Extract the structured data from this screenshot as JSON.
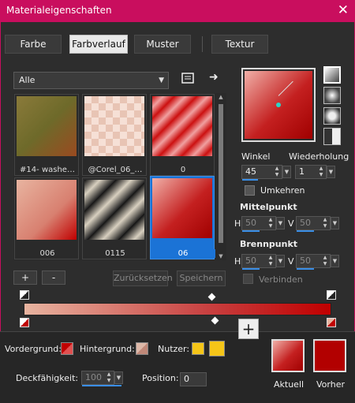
{
  "window": {
    "title": "Materialeigenschaften",
    "close_label": "✕"
  },
  "tabs": [
    "Farbe",
    "Farbverlauf",
    "Muster",
    "Textur"
  ],
  "category": {
    "value": "Alle"
  },
  "thumbnails": [
    {
      "caption": "#14- washe…"
    },
    {
      "caption": "@Corel_06_…"
    },
    {
      "caption": "0"
    },
    {
      "caption": "006"
    },
    {
      "caption": "0115"
    },
    {
      "caption": "06"
    }
  ],
  "buttons": {
    "add": "+",
    "remove": "-",
    "reset": "Zurücksetzen",
    "save": "Speichern"
  },
  "params": {
    "angle_label": "Winkel",
    "angle_value": "45",
    "repeat_label": "Wiederholung",
    "repeat_value": "1",
    "invert_label": "Umkehren",
    "center_label": "Mittelpunkt",
    "center_h": "50",
    "center_v": "50",
    "focus_label": "Brennpunkt",
    "focus_h": "50",
    "focus_v": "50",
    "link_label": "Verbinden",
    "h": "H",
    "v": "V"
  },
  "bottom": {
    "foreground_label": "Vordergrund:",
    "background_label": "Hintergrund:",
    "user_label": "Nutzer:",
    "opacity_label": "Deckfähigkeit:",
    "opacity_value": "100",
    "position_label": "Position:",
    "position_value": "0",
    "current_label": "Aktuell",
    "previous_label": "Vorher",
    "plus": "+"
  },
  "colors": {
    "accent": "#c90e5e",
    "current": "#c00000",
    "previous": "#b20000",
    "user": "#f5c518",
    "selection": "#1b73d6"
  }
}
